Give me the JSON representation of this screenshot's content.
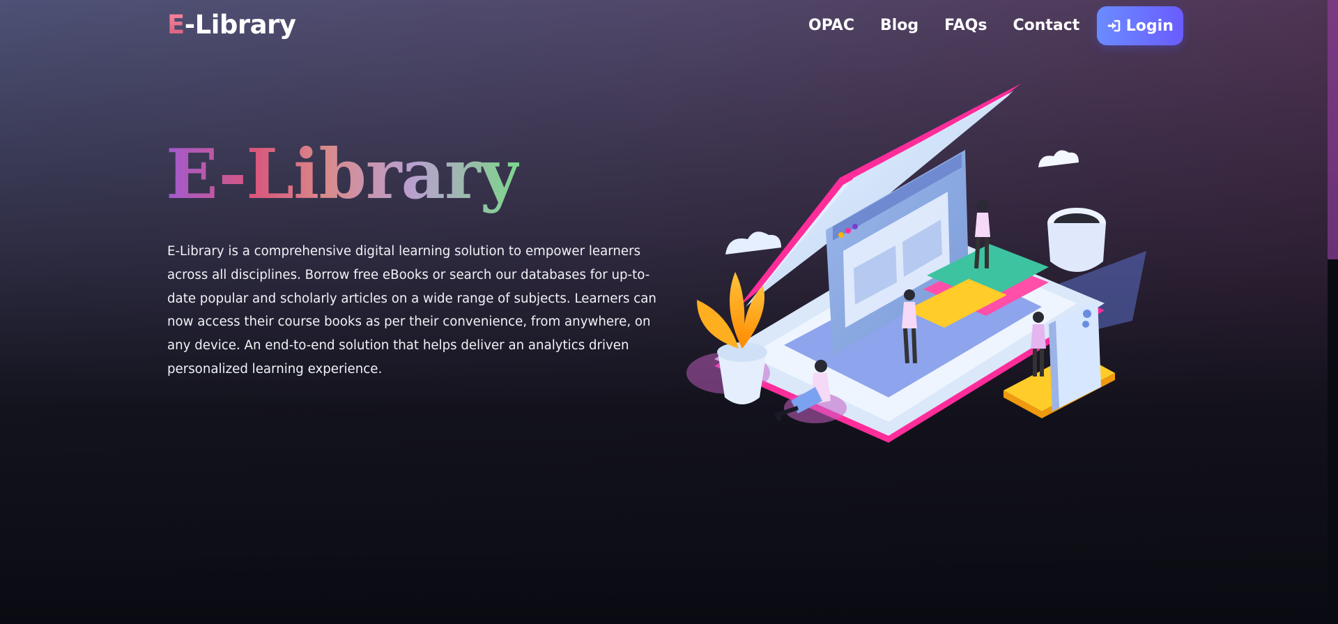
{
  "header": {
    "logo_first": "E",
    "logo_rest": "-Library",
    "nav": [
      {
        "label": "OPAC"
      },
      {
        "label": "Blog"
      },
      {
        "label": "FAQs"
      },
      {
        "label": "Contact"
      }
    ],
    "login_label": "Login",
    "login_icon": "sign-in-icon"
  },
  "hero": {
    "title": "E-Library",
    "description": "E-Library is a comprehensive digital learning solution to empower learners across all disciplines. Borrow free eBooks or search our databases for up-to-date popular and scholarly articles on a wide range of subjects. Learners can now access their course books as per their convenience, from anywhere, on any device. An end-to-end solution that helps deliver an analytics driven personalized learning experience."
  },
  "colors": {
    "accent_login": "#6a7cff",
    "logo_accent": "#e0688a",
    "book_pink": "#ff2d9a",
    "page_blue": "#cfe4ff"
  }
}
